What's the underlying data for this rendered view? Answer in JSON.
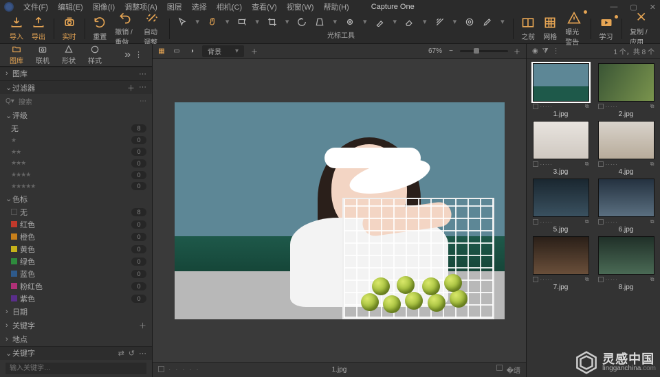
{
  "app": {
    "title": "Capture One"
  },
  "menu": [
    "文件(F)",
    "编辑(E)",
    "图像(I)",
    "调整项(A)",
    "图层",
    "选择",
    "相机(C)",
    "查看(V)",
    "视窗(W)",
    "帮助(H)"
  ],
  "toolbar": {
    "import": "导入",
    "export": "导出",
    "live": "实时",
    "reset": "重置",
    "undo_redo": "撤销 / 重做",
    "auto": "自动调整",
    "cursor_group": "光标工具",
    "before": "之前",
    "grid": "网格",
    "exposure_warn": "曝光警告",
    "learn": "学习",
    "copy_apply": "复制 / 应用"
  },
  "leftTabs": {
    "library": "图库",
    "tether": "联机",
    "shape": "形状",
    "style": "样式"
  },
  "panels": {
    "library": "图库",
    "filter": "过滤器",
    "search_placeholder": "搜索",
    "rating": "评级",
    "rating_none": "无",
    "rating_count_none": "8",
    "rating_count_other": "0",
    "color": "色标",
    "colors": [
      {
        "name": "无",
        "hex": "transparent",
        "count": "8"
      },
      {
        "name": "红色",
        "hex": "#c0392b",
        "count": "0"
      },
      {
        "name": "橙色",
        "hex": "#c77f1a",
        "count": "0"
      },
      {
        "name": "黄色",
        "hex": "#c7b21a",
        "count": "0"
      },
      {
        "name": "绿色",
        "hex": "#2e8b3d",
        "count": "0"
      },
      {
        "name": "蓝色",
        "hex": "#2e5a8b",
        "count": "0"
      },
      {
        "name": "粉红色",
        "hex": "#b03077",
        "count": "0"
      },
      {
        "name": "紫色",
        "hex": "#5a2e8b",
        "count": "0"
      }
    ],
    "date": "日期",
    "keyword": "关键字",
    "place": "地点",
    "keywords_section": "关键字",
    "kw_placeholder": "输入关键字…"
  },
  "viewer": {
    "layer_dd": "背景",
    "zoom": "67%",
    "filename": "1.jpg"
  },
  "browser": {
    "count": "1 个，共 8 个",
    "items": [
      "1.jpg",
      "2.jpg",
      "3.jpg",
      "4.jpg",
      "5.jpg",
      "6.jpg",
      "7.jpg",
      "8.jpg"
    ]
  },
  "watermark": {
    "cn": "灵感中国",
    "en": "lingganchina",
    "tld": ".com"
  }
}
